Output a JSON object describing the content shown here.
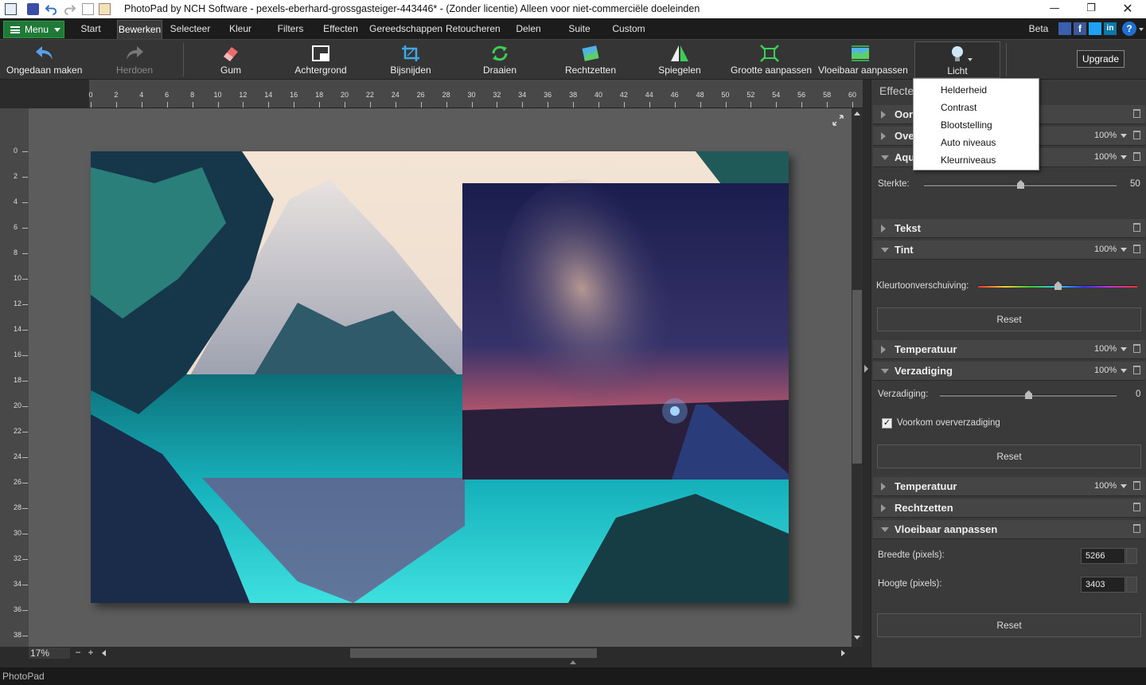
{
  "window": {
    "title": "PhotoPad by NCH Software - pexels-eberhard-grossgasteiger-443446* - (Zonder licentie) Alleen voor niet-commerciële doeleinden"
  },
  "menubar": {
    "menu_label": "Menu",
    "tabs": [
      "Start",
      "Bewerken",
      "Selecteer",
      "Kleur",
      "Filters",
      "Effecten",
      "Gereedschappen",
      "Retoucheren",
      "Delen",
      "Suite",
      "Custom"
    ],
    "active_tab": "Bewerken",
    "beta_label": "Beta"
  },
  "toolbar": {
    "undo": "Ongedaan maken",
    "redo": "Herdoen",
    "eraser": "Gum",
    "background": "Achtergrond",
    "crop": "Bijsnijden",
    "rotate": "Draaien",
    "straighten": "Rechtzetten",
    "mirror": "Spiegelen",
    "resize": "Grootte aanpassen",
    "liquid_resize": "Vloeibaar aanpassen",
    "light": "Licht",
    "upgrade": "Upgrade"
  },
  "light_menu": {
    "items": [
      "Helderheid",
      "Contrast",
      "Blootstelling",
      "Auto niveaus",
      "Kleurniveaus"
    ]
  },
  "ruler": {
    "h_ticks": [
      "0",
      "2",
      "4",
      "6",
      "8",
      "10",
      "12",
      "14",
      "16",
      "18",
      "20",
      "22",
      "24",
      "26",
      "28",
      "30",
      "32",
      "34",
      "36",
      "38",
      "40",
      "42",
      "44",
      "46",
      "48",
      "50",
      "52",
      "54",
      "56",
      "58",
      "60"
    ],
    "v_ticks": [
      "0",
      "2",
      "4",
      "6",
      "8",
      "10",
      "12",
      "14",
      "16",
      "18",
      "20",
      "22",
      "24",
      "26",
      "28",
      "30",
      "32",
      "34",
      "36",
      "38"
    ]
  },
  "zoom": "17%",
  "status": "PhotoPad",
  "effects_panel": {
    "header": "Effecte",
    "sections": {
      "s1": {
        "title": "Oor"
      },
      "s2": {
        "title": "Ove",
        "pct": "100%"
      },
      "s3": {
        "title": "Aqu",
        "pct": "100%",
        "strength_label": "Sterkte:",
        "strength_value": "50",
        "strength_level": 0.5
      },
      "text": {
        "title": "Tekst"
      },
      "tint": {
        "title": "Tint",
        "pct": "100%",
        "hue_label": "Kleurtoonverschuiving:",
        "hue_level": 0.5,
        "reset": "Reset"
      },
      "temp1": {
        "title": "Temperatuur",
        "pct": "100%"
      },
      "sat": {
        "title": "Verzadiging",
        "pct": "100%",
        "label": "Verzadiging:",
        "value": "0",
        "level": 0.5,
        "check_label": "Voorkom oververzadiging",
        "checked": true,
        "reset": "Reset"
      },
      "temp2": {
        "title": "Temperatuur",
        "pct": "100%"
      },
      "straight": {
        "title": "Rechtzetten"
      },
      "liquid": {
        "title": "Vloeibaar aanpassen",
        "width_label": "Breedte (pixels):",
        "width": "5266",
        "height_label": "Hoogte (pixels):",
        "height": "3403",
        "reset": "Reset"
      }
    }
  }
}
